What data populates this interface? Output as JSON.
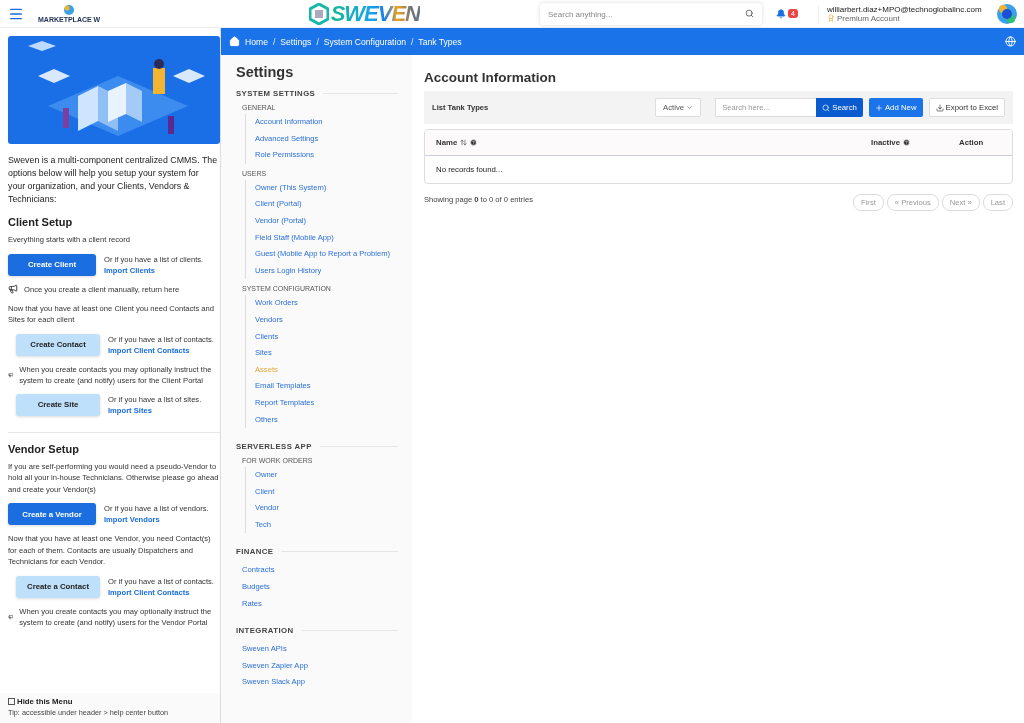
{
  "header": {
    "small_logo_text": "MARKETPLACE W",
    "logo_text": "SWEVEN",
    "search": {
      "placeholder": "Search anything..."
    },
    "notifications": "4",
    "user_email": "williarbert.diaz+MPO@technoglobalinc.com",
    "account_type": "Premium Account"
  },
  "left_panel": {
    "intro": "Sweven is a multi-component centralized CMMS. The options below will help you setup your system for your organization, and your Clients, Vendors & Technicians:",
    "sections": [
      {
        "title": "Client Setup",
        "blocks": [
          {
            "kind": "text",
            "text": "Everything starts with a client record"
          },
          {
            "kind": "action",
            "button": "Create Client",
            "primary": true,
            "note": "Or if you have a list of clients.",
            "link": "Import Clients"
          },
          {
            "kind": "tip",
            "text": "Once you create a client manually, return here"
          },
          {
            "kind": "text",
            "text": "Now that you have at least one Client you need Contacts and Sites for  each client"
          },
          {
            "kind": "action",
            "button": "Create Contact",
            "primary": false,
            "note": "Or if you have a list of contacts.",
            "link": "Import Client Contacts"
          },
          {
            "kind": "tip",
            "text": "When you create contacts you may optionally instruct the system to create (and notify) users for the Client Portal"
          },
          {
            "kind": "action",
            "button": "Create Site",
            "primary": false,
            "note": "Or if you have a list of sites.",
            "link": "Import Sites"
          }
        ]
      },
      {
        "title": "Vendor Setup",
        "blocks": [
          {
            "kind": "text",
            "text": "If you are self-performing you would need a pseudo-Vendor to hold all your in-house Technicians. Otherwise please go ahead and create your Vendor(s)"
          },
          {
            "kind": "action",
            "button": "Create a Vendor",
            "primary": true,
            "note": "Or if you have a list of vendors.",
            "link": "Import Vendors"
          },
          {
            "kind": "text",
            "text": "Now that you have at least one Vendor, you need Contact(s) for each of them. Contacts are usually Dispatchers and Technicians for each Vendor."
          },
          {
            "kind": "action",
            "button": "Create a Contact",
            "primary": false,
            "note": "Or if you have a list of contacts.",
            "link": "Import Client Contacts"
          },
          {
            "kind": "tip",
            "text": "When you create contacts you may optionally instruct the system to create (and notify) users for the Vendor Portal"
          }
        ]
      }
    ],
    "hide_menu": {
      "label": "Hide this Menu",
      "checked": false
    },
    "tip": "Tip: accessible under header > help center button"
  },
  "breadcrumb": {
    "separator": "/",
    "items": [
      "Home",
      "Settings",
      "System Configuration",
      "Tank Types"
    ]
  },
  "settings": {
    "title": "Settings",
    "sections": [
      {
        "title": "SYSTEM SETTINGS",
        "children": [
          {
            "label": "GENERAL",
            "children": [
              {
                "label": "Account Information",
                "selected": false
              },
              {
                "label": "Advanced Settings",
                "selected": false
              },
              {
                "label": "Role Permissions",
                "selected": false
              }
            ]
          },
          {
            "label": "USERS",
            "children": [
              {
                "label": "Owner (This System)",
                "selected": false
              },
              {
                "label": "Client (Portal)",
                "selected": false
              },
              {
                "label": "Vendor (Portal)",
                "selected": false
              },
              {
                "label": "Field Staff (Mobile App)",
                "selected": false
              },
              {
                "label": "Guest (Mobile App to Report a Problem)",
                "selected": false
              },
              {
                "label": "Users Login History",
                "selected": false
              }
            ]
          },
          {
            "label": "SYSTEM CONFIGURATION",
            "children": [
              {
                "label": "Work Orders",
                "selected": false
              },
              {
                "label": "Vendors",
                "selected": false
              },
              {
                "label": "Clients",
                "selected": false
              },
              {
                "label": "Sites",
                "selected": false
              },
              {
                "label": "Assets",
                "selected": true
              },
              {
                "label": "Email Templates",
                "selected": false
              },
              {
                "label": "Report Templates",
                "selected": false
              },
              {
                "label": "Others",
                "selected": false
              }
            ]
          }
        ]
      },
      {
        "title": "SERVERLESS APP",
        "children": [
          {
            "label": "FOR WORK ORDERS",
            "children": [
              {
                "label": "Owner",
                "selected": false
              },
              {
                "label": "Client",
                "selected": false
              },
              {
                "label": "Vendor",
                "selected": false
              },
              {
                "label": "Tech",
                "selected": false
              }
            ]
          }
        ]
      },
      {
        "title": "FINANCE",
        "children": [
          {
            "label": "Contracts",
            "selected": false
          },
          {
            "label": "Budgets",
            "selected": false
          },
          {
            "label": "Rates",
            "selected": false
          }
        ]
      },
      {
        "title": "INTEGRATION",
        "children": [
          {
            "label": "Sweven APIs",
            "selected": false
          },
          {
            "label": "Sweven Zapier App",
            "selected": false
          },
          {
            "label": "Sweven Slack App",
            "selected": false
          }
        ]
      }
    ]
  },
  "main": {
    "title": "Account Information",
    "list_title": "List Tank Types",
    "filter": "Active",
    "search": {
      "placeholder": "Search here..."
    },
    "search_button": "Search",
    "add_button": "Add New",
    "export_button": "Export to Excel",
    "table": {
      "columns": [
        "Name",
        "Inactive",
        "Action"
      ],
      "empty": "No records found..."
    },
    "summary": "Showing page **0** to 0 of 0 entries",
    "pagination": [
      "First",
      "« Previous",
      "Next »",
      "Last"
    ]
  }
}
